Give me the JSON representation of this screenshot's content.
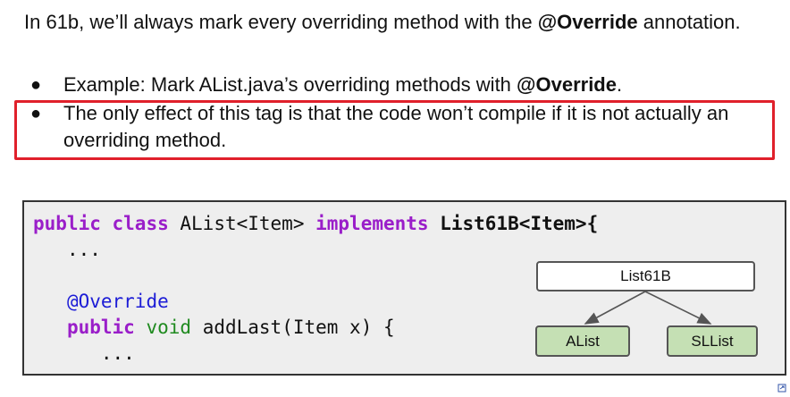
{
  "intro": {
    "text_before": "In 61b, we’ll always mark every overriding method with the ",
    "bold": "@Override",
    "text_after": " annotation."
  },
  "bullets": [
    {
      "text_before": "Example: Mark AList.java’s overriding methods with ",
      "bold": "@Override",
      "text_after": "."
    },
    {
      "text": "The only effect of this tag is that the code won’t compile if it is not actually an overriding method."
    }
  ],
  "bullet_symbol": "●",
  "code": {
    "line1": {
      "kw1": "public",
      "kw2": "class",
      "name": "AList<Item>",
      "kw3": "implements",
      "iface": "List61B<Item>{"
    },
    "line2": "...",
    "line4": "@Override",
    "line5": {
      "kw": "public",
      "type": "void",
      "rest": "addLast(Item x) {"
    },
    "line6": "..."
  },
  "diagram": {
    "parent": "List61B",
    "children": [
      "AList",
      "SLList"
    ]
  },
  "colors": {
    "highlight_border": "#e0202b",
    "keyword": "#9a1ec9",
    "annotation": "#1c1cd6",
    "void_type": "#1f8a1f",
    "child_node_fill": "#c5e0b4",
    "code_background": "#eeeeee"
  },
  "icons": {
    "corner": "slide-link-icon"
  }
}
